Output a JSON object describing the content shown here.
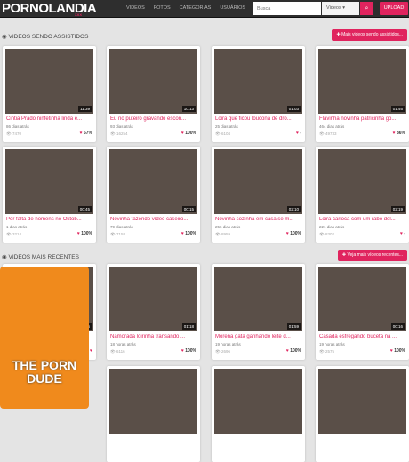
{
  "nav": {
    "logo": "PORNOLANDIA",
    "logo_sub": "XXX",
    "menu": [
      "VIDEOS",
      "FOTOS",
      "CATEGORIAS",
      "USUÁRIOS"
    ],
    "search_placeholder": "Busca",
    "search_type": "Videos",
    "upload": "UPLOAD"
  },
  "sections": [
    {
      "title": "VIDEOS SENDO ASSISTIDOS",
      "more": "Mais videos sendo assistidos...",
      "videos": [
        {
          "title": "Cintia Prado ninfetinha linda e...",
          "date": "86 dias atrás",
          "views": "7470",
          "rating": "67%",
          "duration": "11:39"
        },
        {
          "title": "Eu no puteiro gravando escon...",
          "date": "93 dias atrás",
          "views": "16254",
          "rating": "100%",
          "duration": "10:13"
        },
        {
          "title": "Loira que ficou loucona de dro...",
          "date": "25 dias atrás",
          "views": "6104",
          "rating": "-",
          "duration": "01:03"
        },
        {
          "title": "Flavinha novinha patricinha go...",
          "date": "464 dias atrás",
          "views": "49733",
          "rating": "86%",
          "duration": "01:46"
        },
        {
          "title": "Por falta de homens no Oktob...",
          "date": "1 dias atrás",
          "views": "3214",
          "rating": "100%",
          "duration": "00:45"
        },
        {
          "title": "Novinha fazendo vídeo caseiro...",
          "date": "79 dias atrás",
          "views": "7158",
          "rating": "100%",
          "duration": "00:15"
        },
        {
          "title": "Novinha sozinha em casa se m...",
          "date": "256 dias atrás",
          "views": "8959",
          "rating": "100%",
          "duration": "02:10"
        },
        {
          "title": "Loira carioca com um rabo del...",
          "date": "221 dias atrás",
          "views": "8302",
          "rating": "-",
          "duration": "02:19"
        }
      ]
    },
    {
      "title": "VIDEOS MAIS RECENTES",
      "more": "Veja mais vídeos recentes...",
      "videos": [
        {
          "title": "G...",
          "date": "18 ...",
          "views": "",
          "rating": "",
          "duration": "01:46"
        },
        {
          "title": "Namorada loirinha transando ...",
          "date": "18 horas atrás",
          "views": "6116",
          "rating": "100%",
          "duration": "01:18"
        },
        {
          "title": "Morena gata ganhando leite d...",
          "date": "19 horas atrás",
          "views": "2696",
          "rating": "100%",
          "duration": "01:59"
        },
        {
          "title": "Casada esfregando buceta na ...",
          "date": "19 horas atrás",
          "views": "2575",
          "rating": "100%",
          "duration": "00:16"
        }
      ]
    }
  ],
  "ad": {
    "text": "THE PORN DUDE"
  }
}
